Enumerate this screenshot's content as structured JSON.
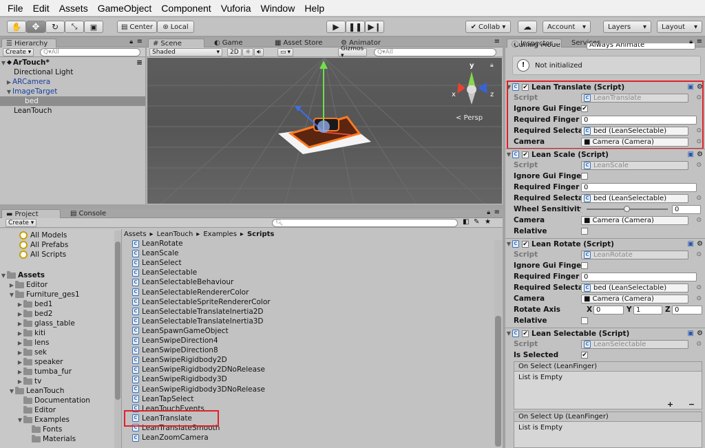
{
  "menu": [
    "File",
    "Edit",
    "Assets",
    "GameObject",
    "Component",
    "Vuforia",
    "Window",
    "Help"
  ],
  "toolbar": {
    "center_label": "Center",
    "local_label": "Local",
    "collab_label": "Collab ▾",
    "account_label": "Account",
    "layers_label": "Layers",
    "layout_label": "Layout"
  },
  "hierarchy": {
    "tab": "Hierarchy",
    "create_label": "Create ▾",
    "search_placeholder": "Q▾All",
    "scene_name": "ArTouch*",
    "items": [
      {
        "label": "Directional Light",
        "indent": 1,
        "arrow": "",
        "color": "#111"
      },
      {
        "label": "ARCamera",
        "indent": 1,
        "arrow": "▶",
        "color": "#1a3fa0"
      },
      {
        "label": "ImageTarget",
        "indent": 1,
        "arrow": "▼",
        "color": "#1a3fa0"
      },
      {
        "label": "bed",
        "indent": 2,
        "arrow": "",
        "color": "#ffffff",
        "selected": true
      },
      {
        "label": "LeanTouch",
        "indent": 1,
        "arrow": "",
        "color": "#111"
      }
    ]
  },
  "scene": {
    "tabs": [
      "Scene",
      "Game",
      "Asset Store",
      "Animator"
    ],
    "shaded_label": "Shaded",
    "mode_2d": "2D",
    "gizmos_label": "Gizmos ▾",
    "search_placeholder": "Q▾All",
    "persp_label": "< Persp",
    "axis_x": "x",
    "axis_y": "y",
    "axis_z": "z"
  },
  "project": {
    "tabs": [
      "Project",
      "Console"
    ],
    "create_label": "Create ▾",
    "favorites": [
      "All Models",
      "All Prefabs",
      "All Scripts"
    ],
    "assets_label": "Assets",
    "tree": [
      {
        "label": "Editor",
        "indent": 1,
        "arrow": "▶"
      },
      {
        "label": "Furniture_ges1",
        "indent": 1,
        "arrow": "▼"
      },
      {
        "label": "bed1",
        "indent": 2,
        "arrow": "▶"
      },
      {
        "label": "bed2",
        "indent": 2,
        "arrow": "▶"
      },
      {
        "label": "glass_table",
        "indent": 2,
        "arrow": "▶"
      },
      {
        "label": "kiti",
        "indent": 2,
        "arrow": "▶"
      },
      {
        "label": "lens",
        "indent": 2,
        "arrow": "▶"
      },
      {
        "label": "sek",
        "indent": 2,
        "arrow": "▶"
      },
      {
        "label": "speaker",
        "indent": 2,
        "arrow": "▶"
      },
      {
        "label": "tumba_fur",
        "indent": 2,
        "arrow": "▶"
      },
      {
        "label": "tv",
        "indent": 2,
        "arrow": "▶"
      },
      {
        "label": "LeanTouch",
        "indent": 1,
        "arrow": "▼"
      },
      {
        "label": "Documentation",
        "indent": 2,
        "arrow": ""
      },
      {
        "label": "Editor",
        "indent": 2,
        "arrow": ""
      },
      {
        "label": "Examples",
        "indent": 2,
        "arrow": "▼"
      },
      {
        "label": "Fonts",
        "indent": 3,
        "arrow": ""
      },
      {
        "label": "Materials",
        "indent": 3,
        "arrow": ""
      }
    ],
    "breadcrumb": [
      "Assets",
      "LeanTouch",
      "Examples",
      "Scripts"
    ],
    "scripts": [
      "LeanRotate",
      "LeanScale",
      "LeanSelect",
      "LeanSelectable",
      "LeanSelectableBehaviour",
      "LeanSelectableRendererColor",
      "LeanSelectableSpriteRendererColor",
      "LeanSelectableTranslateInertia2D",
      "LeanSelectableTranslateInertia3D",
      "LeanSpawnGameObject",
      "LeanSwipeDirection4",
      "LeanSwipeDirection8",
      "LeanSwipeRigidbody2D",
      "LeanSwipeRigidbody2DNoRelease",
      "LeanSwipeRigidbody3D",
      "LeanSwipeRigidbody3DNoRelease",
      "LeanTapSelect",
      "LeanTouchEvents",
      "LeanTranslate",
      "LeanTranslateSmooth",
      "LeanZoomCamera"
    ],
    "highlighted_script_index": 18
  },
  "inspector": {
    "tabs": [
      "Inspector",
      "Services"
    ],
    "culling_label": "Culling Mode",
    "culling_value": "Always Animate",
    "not_initialized": "Not initialized",
    "translate": {
      "title": "Lean Translate (Script)",
      "script_label": "Script",
      "script_value": "LeanTranslate",
      "ignore_label": "Ignore Gui Fingers",
      "ignore_checked": "✔",
      "req_finger_label": "Required Finger Count",
      "req_finger_value": "0",
      "req_select_label": "Required Selectable",
      "req_select_value": "bed (LeanSelectable)",
      "camera_label": "Camera",
      "camera_value": "Camera (Camera)"
    },
    "scale": {
      "title": "Lean Scale (Script)",
      "script_label": "Script",
      "script_value": "LeanScale",
      "ignore_label": "Ignore Gui Fingers",
      "req_finger_label": "Required Finger Count",
      "req_finger_value": "0",
      "req_select_label": "Required Selectable",
      "req_select_value": "bed (LeanSelectable)",
      "wheel_label": "Wheel Sensitivity",
      "wheel_value": "0",
      "camera_label": "Camera",
      "camera_value": "Camera (Camera)",
      "relative_label": "Relative"
    },
    "rotate": {
      "title": "Lean Rotate (Script)",
      "script_label": "Script",
      "script_value": "LeanRotate",
      "ignore_label": "Ignore Gui Fingers",
      "req_finger_label": "Required Finger Count",
      "req_finger_value": "0",
      "req_select_label": "Required Selectable",
      "req_select_value": "bed (LeanSelectable)",
      "camera_label": "Camera",
      "camera_value": "Camera (Camera)",
      "axis_label": "Rotate Axis",
      "axis_x_label": "X",
      "axis_x": "0",
      "axis_y_label": "Y",
      "axis_y": "1",
      "axis_z_label": "Z",
      "axis_z": "0",
      "relative_label": "Relative"
    },
    "selectable": {
      "title": "Lean Selectable (Script)",
      "script_label": "Script",
      "script_value": "LeanSelectable",
      "selected_label": "Is Selected",
      "selected_checked": "✔",
      "on_select": "On Select (LeanFinger)",
      "on_select_up": "On Select Up (LeanFinger)",
      "list_empty": "List is Empty",
      "plus": "+",
      "minus": "−"
    }
  }
}
